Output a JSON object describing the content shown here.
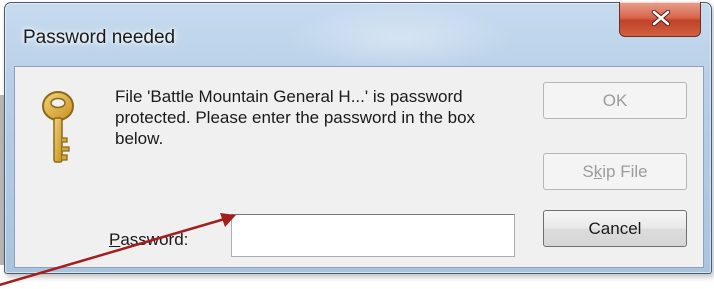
{
  "dialog": {
    "title": "Password needed",
    "close_label": "X",
    "message": "File 'Battle Mountain General H...' is password protected.  Please enter the password in the box below.",
    "buttons": {
      "ok": "OK",
      "skip_file_pre": "S",
      "skip_file_accel": "k",
      "skip_file_post": "ip File",
      "cancel": "Cancel"
    },
    "password_label_accel": "P",
    "password_label_rest": "assword:",
    "password_value": ""
  },
  "icons": [
    "key-icon",
    "close-icon",
    "annotation-arrow"
  ],
  "colors": {
    "close_button": "#c1422a",
    "annotation_arrow": "#a31f1f",
    "title_bar": "#b7cfe8"
  }
}
